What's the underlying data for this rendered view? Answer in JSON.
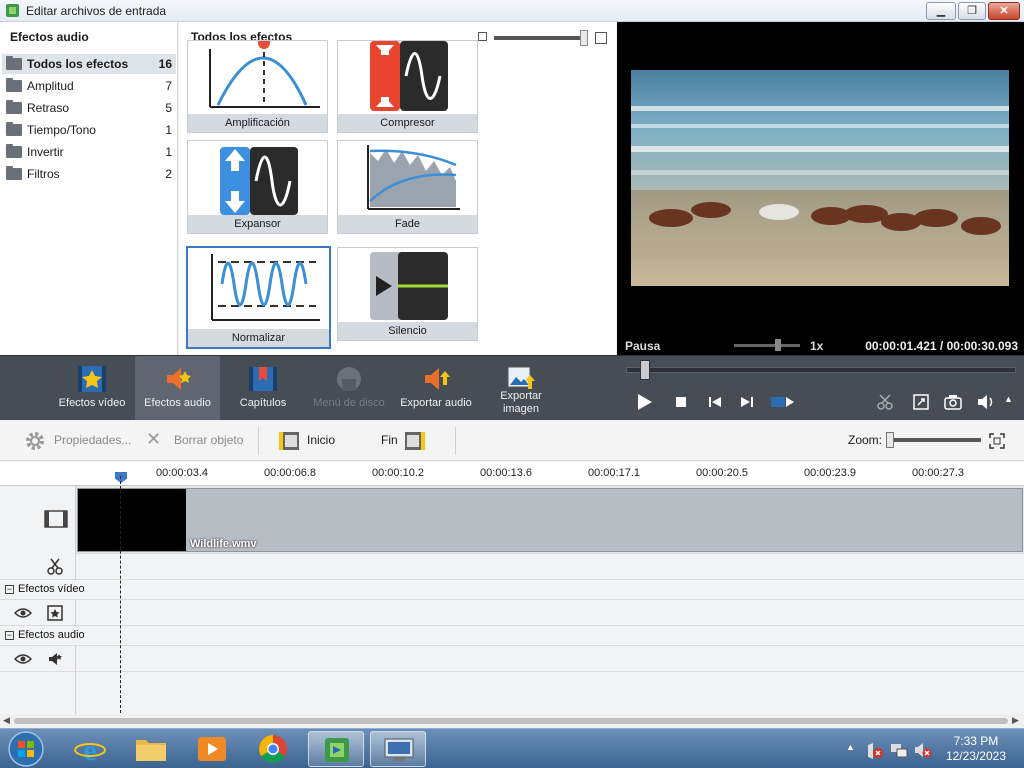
{
  "window": {
    "title": "Editar archivos de entrada",
    "minimize": "▁",
    "maximize": "❐",
    "close": "✕"
  },
  "categories": {
    "header": "Efectos audio",
    "items": [
      {
        "label": "Todos los efectos",
        "count": "16"
      },
      {
        "label": "Amplitud",
        "count": "7"
      },
      {
        "label": "Retraso",
        "count": "5"
      },
      {
        "label": "Tiempo/Tono",
        "count": "1"
      },
      {
        "label": "Invertir",
        "count": "1"
      },
      {
        "label": "Filtros",
        "count": "2"
      }
    ]
  },
  "effects": {
    "header": "Todos los efectos",
    "tiles": [
      "Amplificación",
      "Compresor",
      "Expansor",
      "Fade",
      "Normalizar",
      "Silencio"
    ]
  },
  "preview": {
    "status": "Pausa",
    "speed": "1x",
    "current_time": "00:00:01.421",
    "separator": "/",
    "total_time": "00:00:30.093"
  },
  "toolbar": {
    "items": [
      "Efectos vídeo",
      "Efectos audio",
      "Capítulos",
      "Menú de disco",
      "Exportar audio",
      "Exportar",
      "imagen"
    ]
  },
  "props": {
    "properties": "Propiedades...",
    "delete": "Borrar objeto",
    "start": "Inicio",
    "end": "Fin",
    "zoom": "Zoom:"
  },
  "timeline": {
    "ticks": [
      "00:00:03.4",
      "00:00:06.8",
      "00:00:10.2",
      "00:00:13.6",
      "00:00:17.1",
      "00:00:20.5",
      "00:00:23.9",
      "00:00:27.3"
    ],
    "clip_name": "Wildlife.wmv",
    "video_effects": "Efectos vídeo",
    "audio_effects": "Efectos audio"
  },
  "taskbar": {
    "time": "7:33 PM",
    "date": "12/23/2023"
  },
  "colors": {
    "accent": "#3b78c4",
    "toolbar": "#474d55",
    "taskbar": "#3d6390"
  }
}
